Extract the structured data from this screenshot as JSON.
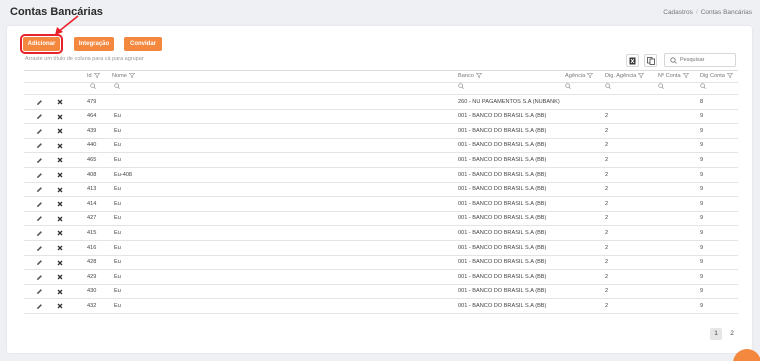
{
  "header": {
    "title": "Contas Bancárias",
    "breadcrumb": [
      "Cadastros",
      "Contas Bancárias"
    ]
  },
  "toolbar": {
    "add_label": "Adicionar",
    "integration_label": "Integração",
    "invite_label": "Convidar",
    "group_hint": "Arraste um título de coluna para cá para agrupar",
    "search_placeholder": "Pesquisar"
  },
  "grid": {
    "columns": [
      "Id",
      "Nome",
      "Banco",
      "Agência",
      "Dig. Agência",
      "Nº Conta",
      "Dig Conta"
    ],
    "rows": [
      {
        "id": "479",
        "nome": "",
        "banco": "260 - NU PAGAMENTOS S.A (NUBANK)",
        "agencia": "",
        "dig_agencia": "",
        "conta": "",
        "dig_conta": "8"
      },
      {
        "id": "464",
        "nome": "Eu",
        "banco": "001 - BANCO DO BRASIL S.A (BB)",
        "agencia": "",
        "dig_agencia": "2",
        "conta": "",
        "dig_conta": "9"
      },
      {
        "id": "439",
        "nome": "Eu",
        "banco": "001 - BANCO DO BRASIL S.A (BB)",
        "agencia": "",
        "dig_agencia": "2",
        "conta": "",
        "dig_conta": "9"
      },
      {
        "id": "440",
        "nome": "Eu",
        "banco": "001 - BANCO DO BRASIL S.A (BB)",
        "agencia": "",
        "dig_agencia": "2",
        "conta": "",
        "dig_conta": "9"
      },
      {
        "id": "465",
        "nome": "Eu",
        "banco": "001 - BANCO DO BRASIL S.A (BB)",
        "agencia": "",
        "dig_agencia": "2",
        "conta": "",
        "dig_conta": "9"
      },
      {
        "id": "408",
        "nome": "Eu-408",
        "banco": "001 - BANCO DO BRASIL S.A (BB)",
        "agencia": "",
        "dig_agencia": "2",
        "conta": "",
        "dig_conta": "9"
      },
      {
        "id": "413",
        "nome": "Eu",
        "banco": "001 - BANCO DO BRASIL S.A (BB)",
        "agencia": "",
        "dig_agencia": "2",
        "conta": "",
        "dig_conta": "9"
      },
      {
        "id": "414",
        "nome": "Eu",
        "banco": "001 - BANCO DO BRASIL S.A (BB)",
        "agencia": "",
        "dig_agencia": "2",
        "conta": "",
        "dig_conta": "9"
      },
      {
        "id": "427",
        "nome": "Eu",
        "banco": "001 - BANCO DO BRASIL S.A (BB)",
        "agencia": "",
        "dig_agencia": "2",
        "conta": "",
        "dig_conta": "9"
      },
      {
        "id": "415",
        "nome": "Eu",
        "banco": "001 - BANCO DO BRASIL S.A (BB)",
        "agencia": "",
        "dig_agencia": "2",
        "conta": "",
        "dig_conta": "9"
      },
      {
        "id": "416",
        "nome": "Eu",
        "banco": "001 - BANCO DO BRASIL S.A (BB)",
        "agencia": "",
        "dig_agencia": "2",
        "conta": "",
        "dig_conta": "9"
      },
      {
        "id": "428",
        "nome": "Eu",
        "banco": "001 - BANCO DO BRASIL S.A (BB)",
        "agencia": "",
        "dig_agencia": "2",
        "conta": "",
        "dig_conta": "9"
      },
      {
        "id": "429",
        "nome": "Eu",
        "banco": "001 - BANCO DO BRASIL S.A (BB)",
        "agencia": "",
        "dig_agencia": "2",
        "conta": "",
        "dig_conta": "9"
      },
      {
        "id": "430",
        "nome": "Eu",
        "banco": "001 - BANCO DO BRASIL S.A (BB)",
        "agencia": "",
        "dig_agencia": "2",
        "conta": "",
        "dig_conta": "9"
      },
      {
        "id": "432",
        "nome": "Eu",
        "banco": "001 - BANCO DO BRASIL S.A (BB)",
        "agencia": "",
        "dig_agencia": "2",
        "conta": "",
        "dig_conta": "9"
      }
    ]
  },
  "pager": {
    "pages": [
      "1",
      "2"
    ],
    "active": "1"
  },
  "colors": {
    "accent": "#f5883f",
    "highlight": "#e8222a",
    "edit_icon": "#555555",
    "delete_icon": "#333333"
  },
  "icons": [
    "pencil-icon",
    "close-icon",
    "filter-icon",
    "search-icon",
    "excel-export-icon",
    "column-chooser-icon",
    "annotation-arrow"
  ]
}
